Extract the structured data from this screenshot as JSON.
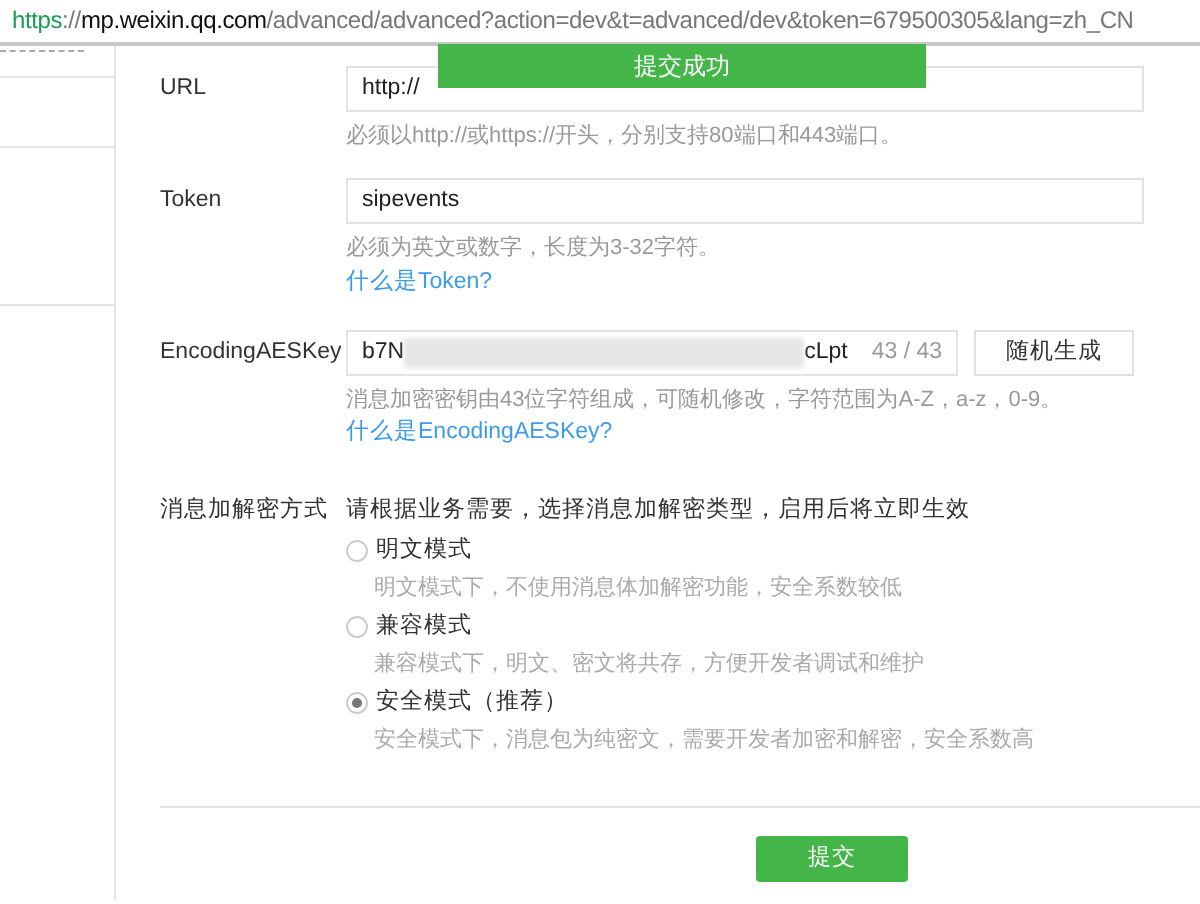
{
  "address_bar": {
    "scheme": "https",
    "separator": "://",
    "host": "mp.weixin.qq.com",
    "path": "/advanced/advanced?action=dev&t=advanced/dev&token=679500305&lang=zh_CN"
  },
  "toast": {
    "text": "提交成功"
  },
  "fields": [
    {
      "kind": "text",
      "label": "URL",
      "value": "http://",
      "hint": "必须以http://或https://开头，分别支持80端口和443端口。"
    },
    {
      "kind": "text",
      "label": "Token",
      "value": "sipevents",
      "hint": "必须为英文或数字，长度为3-32字符。",
      "link": "什么是Token?"
    },
    {
      "kind": "key",
      "label": "EncodingAESKey",
      "value_start": "b7N",
      "value_end": "cLpt",
      "counter": "43 / 43",
      "button": "随机生成",
      "hint": "消息加密密钥由43位字符组成，可随机修改，字符范围为A-Z，a-z，0-9。",
      "link": "什么是EncodingAESKey?"
    }
  ],
  "encryption": {
    "label": "消息加解密方式",
    "intro": "请根据业务需要，选择消息加解密类型，启用后将立即生效",
    "options": [
      {
        "label": "明文模式",
        "description": "明文模式下，不使用消息体加解密功能，安全系数较低",
        "selected": false
      },
      {
        "label": "兼容模式",
        "description": "兼容模式下，明文、密文将共存，方便开发者调试和维护",
        "selected": false
      },
      {
        "label": "安全模式（推荐）",
        "description": "安全模式下，消息包为纯密文，需要开发者加密和解密，安全系数高",
        "selected": true
      }
    ]
  },
  "submit": "提交"
}
